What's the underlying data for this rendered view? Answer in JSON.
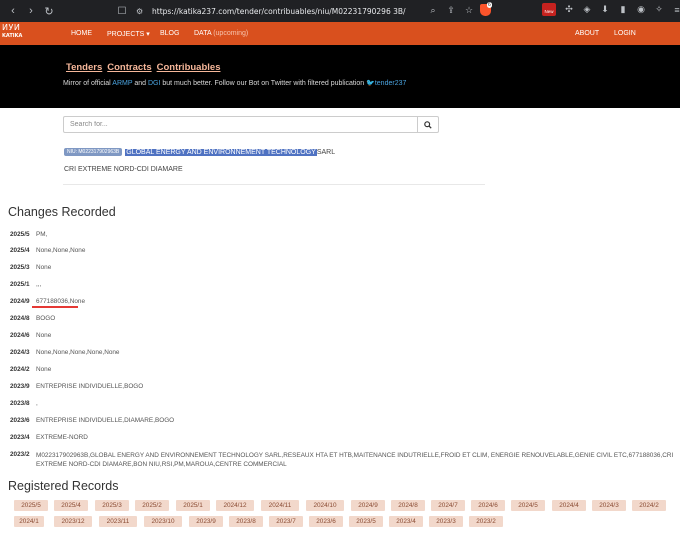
{
  "browser": {
    "url": "https://katika237.com/tender/contribuables/niu/M02231790296 3B/",
    "ext_count": "6",
    "new_badge": "New"
  },
  "navbar": {
    "logo_top": "ИУИ",
    "logo_bottom": "KATIKA",
    "home": "HOME",
    "projects": "PROJECTS ▾",
    "blog": "BLOG",
    "data_label": "DATA",
    "data_sub": "(upcoming)",
    "about": "ABOUT",
    "login": "LOGIN"
  },
  "hero": {
    "links": [
      "Tenders",
      "Contracts",
      "Contribuables"
    ],
    "mirror_prefix": "Mirror of official ",
    "armp": "ARMP",
    "and": " and ",
    "dgi": "DGI",
    "mirror_suffix": " but much better. Follow our Bot on Twitter with filtered publication ",
    "twitter": "🐦tender237"
  },
  "search": {
    "placeholder": "Search for..."
  },
  "company": {
    "niu": "NIU: M022317902963B",
    "name": "GLOBAL ENERGY AND ENVIRONNEMENT TECHNOLOGY",
    "suffix": " SARL",
    "cri": "CRI EXTREME NORD-CDI DIAMARE"
  },
  "changes": {
    "title": "Changes Recorded",
    "rows": [
      {
        "period": "2025/5",
        "value": "PM,"
      },
      {
        "period": "2025/4",
        "value": "None,None,None"
      },
      {
        "period": "2025/3",
        "value": "None"
      },
      {
        "period": "2025/1",
        "value": ",,,"
      },
      {
        "period": "2024/9",
        "value": "677188036,None"
      },
      {
        "period": "2024/8",
        "value": "BOGO"
      },
      {
        "period": "2024/6",
        "value": "None"
      },
      {
        "period": "2024/3",
        "value": "None,None,None,None,None"
      },
      {
        "period": "2024/2",
        "value": "None"
      },
      {
        "period": "2023/9",
        "value": "ENTREPRISE INDIVIDUELLE,BOGO"
      },
      {
        "period": "2023/8",
        "value": ","
      },
      {
        "period": "2023/6",
        "value": "ENTREPRISE INDIVIDUELLE,DIAMARE,BOGO"
      },
      {
        "period": "2023/4",
        "value": "EXTREME-NORD"
      },
      {
        "period": "2023/2",
        "value": "M022317902963B,GLOBAL ENERGY AND ENVIRONNEMENT TECHNOLOGY SARL,RESEAUX HTA ET HTB,MAITENANCE INDUTRIELLE,FROID ET CLIM, ENERGIE RENOUVELABLE,GENIE CIVIL ETC,677188036,CRI EXTREME NORD-CDI DIAMARE,BON NIU,RSI,PM,MAROUA,CENTRE COMMERCIAL"
      }
    ]
  },
  "records": {
    "title": "Registered Records",
    "items": [
      "2025/5",
      "2025/4",
      "2025/3",
      "2025/2",
      "2025/1",
      "2024/12",
      "2024/11",
      "2024/10",
      "2024/9",
      "2024/8",
      "2024/7",
      "2024/6",
      "2024/5",
      "2024/4",
      "2024/3",
      "2024/2",
      "2024/1",
      "2023/12",
      "2023/11",
      "2023/10",
      "2023/9",
      "2023/8",
      "2023/7",
      "2023/6",
      "2023/5",
      "2023/4",
      "2023/3",
      "2023/2"
    ]
  }
}
